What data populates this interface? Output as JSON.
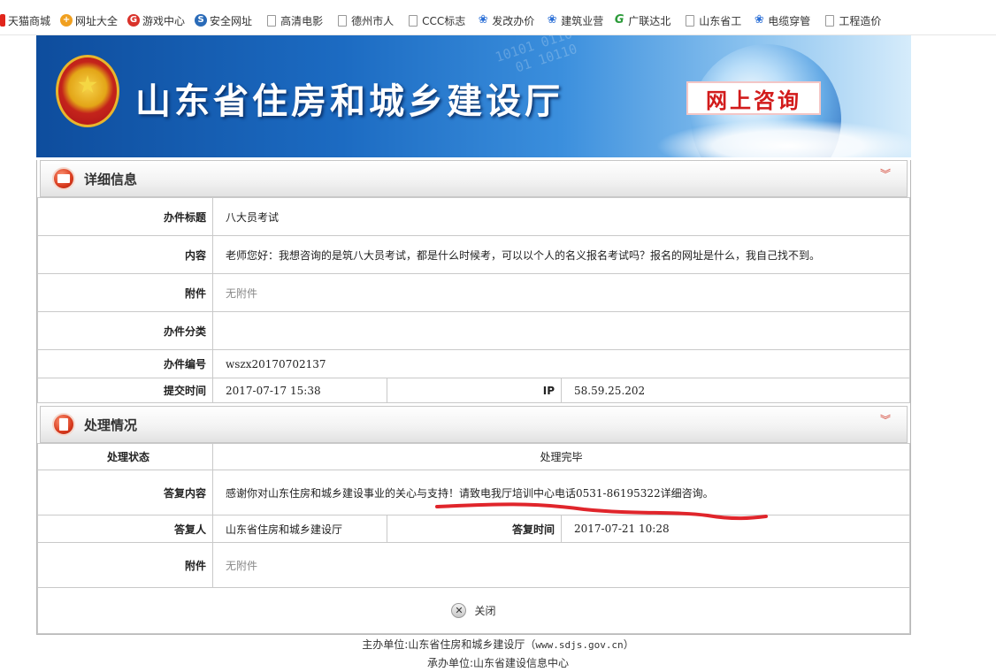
{
  "bookmarks": [
    {
      "label": "天猫商城",
      "icon": "tmall-icon"
    },
    {
      "label": "网址大全",
      "icon": "web-directory-icon"
    },
    {
      "label": "游戏中心",
      "icon": "game-center-icon"
    },
    {
      "label": "安全网址",
      "icon": "safe-sites-icon"
    },
    {
      "label": "高清电影",
      "icon": "page-icon"
    },
    {
      "label": "德州市人",
      "icon": "page-icon"
    },
    {
      "label": "CCC标志",
      "icon": "page-icon"
    },
    {
      "label": "发改办价",
      "icon": "paw-icon"
    },
    {
      "label": "建筑业营",
      "icon": "paw-icon"
    },
    {
      "label": "广联达北",
      "icon": "glodon-icon"
    },
    {
      "label": "山东省工",
      "icon": "page-icon"
    },
    {
      "label": "电缆穿管",
      "icon": "paw-icon"
    },
    {
      "label": "工程造价",
      "icon": "page-icon"
    }
  ],
  "banner": {
    "title": "山东省住房和城乡建设厅",
    "badge": "网上咨询"
  },
  "detail": {
    "section_title": "详细信息",
    "subject_label": "办件标题",
    "subject_value": "八大员考试",
    "content_label": "内容",
    "content_value": "老师您好：我想咨询的是筑八大员考试，都是什么时候考，可以以个人的名义报名考试吗？报名的网址是什么，我自己找不到。",
    "attachment_label": "附件",
    "attachment_value": "无附件",
    "category_label": "办件分类",
    "category_value": "",
    "number_label": "办件编号",
    "number_value": "wszx20170702137",
    "submit_time_label": "提交时间",
    "submit_time_value": "2017-07-17 15:38",
    "ip_label": "IP",
    "ip_value": "58.59.25.202"
  },
  "handling": {
    "section_title": "处理情况",
    "status_label": "处理状态",
    "status_value": "处理完毕",
    "reply_label": "答复内容",
    "reply_value": "感谢你对山东住房和城乡建设事业的关心与支持！请致电我厅培训中心电话0531-86195322详细咨询。",
    "replier_label": "答复人",
    "replier_value": "山东省住房和城乡建设厅",
    "reply_time_label": "答复时间",
    "reply_time_value": "2017-07-21 10:28",
    "attachment_label": "附件",
    "attachment_value": "无附件"
  },
  "close_label": "关闭",
  "footer": {
    "host": "主办单位:山东省住房和城乡建设厅（",
    "host_url": "www.sdjs.gov.cn",
    "host_end": "）",
    "organizer": "承办单位:山东省建设信息中心"
  },
  "annotation_color": "#e0252b"
}
